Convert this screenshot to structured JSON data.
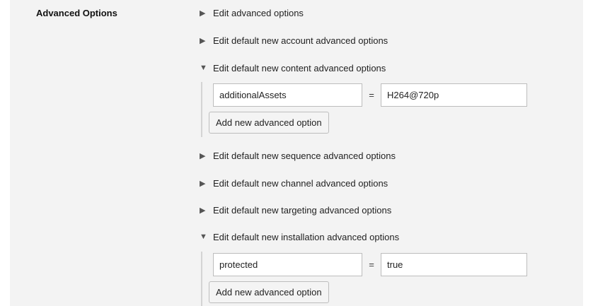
{
  "section": {
    "label": "Advanced Options"
  },
  "options": [
    {
      "label": "Edit advanced options",
      "expanded": false,
      "toggle_glyph": "▶"
    },
    {
      "label": "Edit default new account advanced options",
      "expanded": false,
      "toggle_glyph": "▶"
    },
    {
      "label": "Edit default new content advanced options",
      "expanded": true,
      "toggle_glyph": "▼",
      "entry": {
        "key": "additionalAssets",
        "separator": "=",
        "value": "H264@720p"
      },
      "add_label": "Add new advanced option"
    },
    {
      "label": "Edit default new sequence advanced options",
      "expanded": false,
      "toggle_glyph": "▶"
    },
    {
      "label": "Edit default new channel advanced options",
      "expanded": false,
      "toggle_glyph": "▶"
    },
    {
      "label": "Edit default new targeting advanced options",
      "expanded": false,
      "toggle_glyph": "▶"
    },
    {
      "label": "Edit default new installation advanced options",
      "expanded": true,
      "toggle_glyph": "▼",
      "entry": {
        "key": "protected",
        "separator": "=",
        "value": "true"
      },
      "add_label": "Add new advanced option"
    }
  ],
  "icons": {
    "collapsed": "triangle-right-icon",
    "expanded": "triangle-down-icon"
  }
}
